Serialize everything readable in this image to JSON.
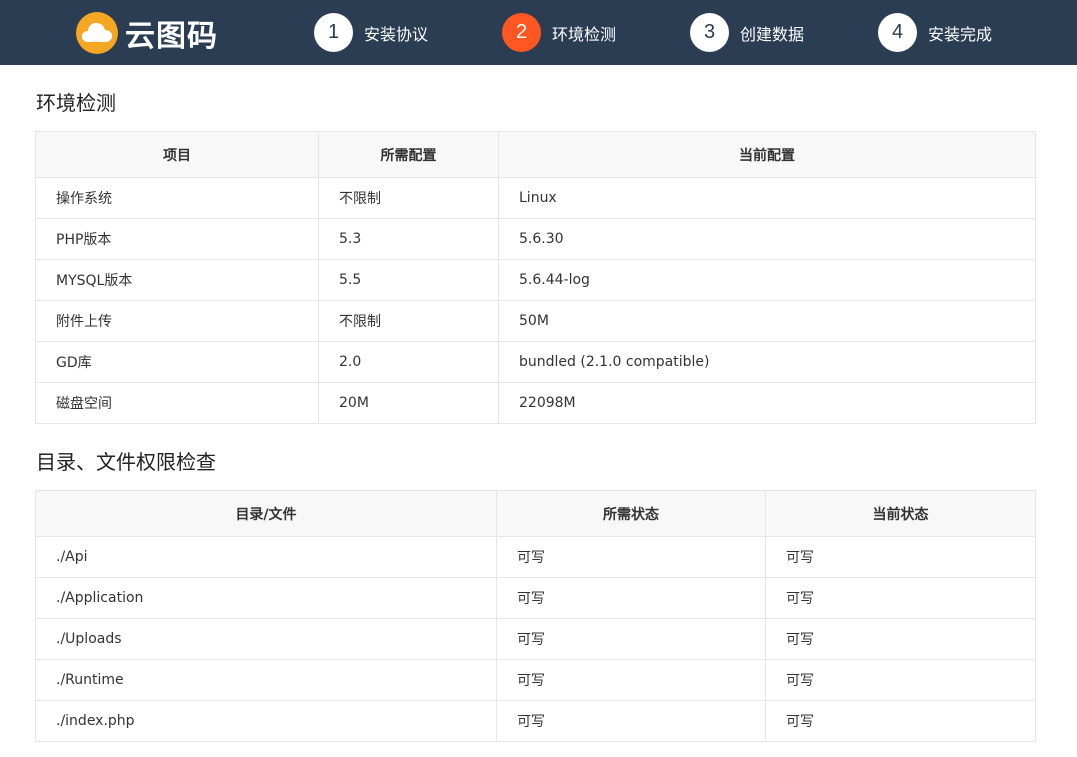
{
  "brand": {
    "name": "云图码"
  },
  "steps": [
    {
      "num": "1",
      "label": "安装协议",
      "active": false
    },
    {
      "num": "2",
      "label": "环境检测",
      "active": true
    },
    {
      "num": "3",
      "label": "创建数据",
      "active": false
    },
    {
      "num": "4",
      "label": "安装完成",
      "active": false
    }
  ],
  "env_section": {
    "title": "环境检测",
    "headers": [
      "项目",
      "所需配置",
      "当前配置"
    ],
    "rows": [
      [
        "操作系统",
        "不限制",
        "Linux"
      ],
      [
        "PHP版本",
        "5.3",
        "5.6.30"
      ],
      [
        "MYSQL版本",
        "5.5",
        "5.6.44-log"
      ],
      [
        "附件上传",
        "不限制",
        "50M"
      ],
      [
        "GD库",
        "2.0",
        "bundled (2.1.0 compatible)"
      ],
      [
        "磁盘空间",
        "20M",
        "22098M"
      ]
    ]
  },
  "perm_section": {
    "title": "目录、文件权限检查",
    "headers": [
      "目录/文件",
      "所需状态",
      "当前状态"
    ],
    "rows": [
      [
        "./Api",
        "可写",
        "可写"
      ],
      [
        "./Application",
        "可写",
        "可写"
      ],
      [
        "./Uploads",
        "可写",
        "可写"
      ],
      [
        "./Runtime",
        "可写",
        "可写"
      ],
      [
        "./index.php",
        "可写",
        "可写"
      ]
    ]
  },
  "colors": {
    "header_bg": "#2b3d53",
    "accent": "#ff5722",
    "logo": "#f5a623"
  },
  "icons": {
    "logo": "cloud-icon"
  }
}
